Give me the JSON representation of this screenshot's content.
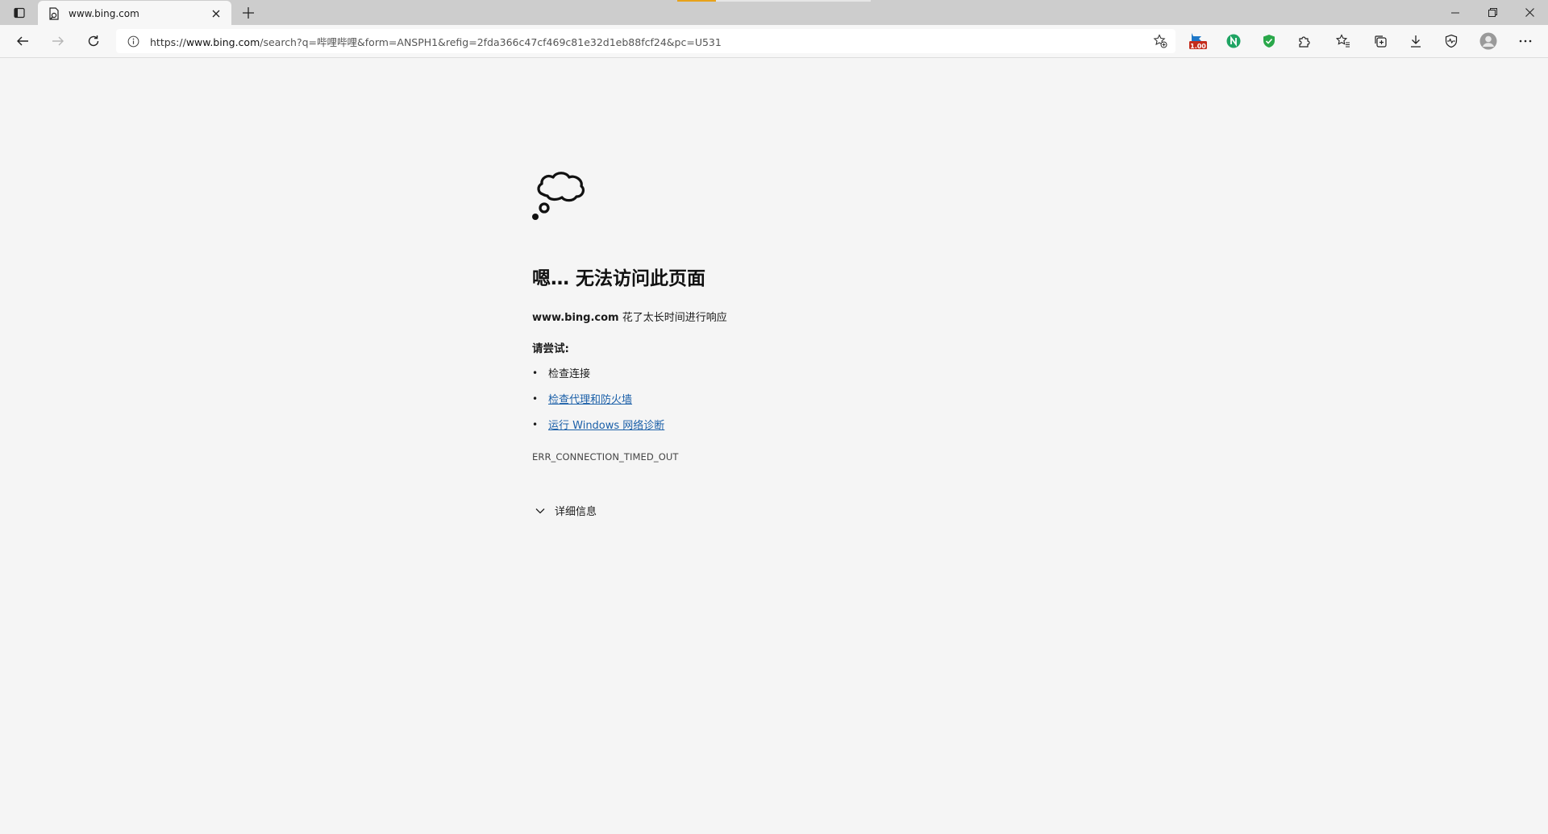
{
  "browser": {
    "tab": {
      "title": "www.bing.com",
      "favicon": "document-icon"
    },
    "address": {
      "scheme": "https://",
      "host": "www.bing.com",
      "path": "/search?q=哔哩哔哩&form=ANSPH1&refig=2fda366c47cf469c81e32d1eb88fcf24&pc=U531"
    },
    "extension_badge": "1.00",
    "accent_colors": {
      "loading": "#e8a21a",
      "badge_red": "#c42b1c",
      "green_ext": "#1fa463",
      "shield_green": "#2aa84a",
      "link": "#1a5fa8"
    }
  },
  "error_page": {
    "title": "嗯… 无法访问此页面",
    "host": "www.bing.com",
    "message": " 花了太长时间进行响应",
    "try_label": "请尝试:",
    "suggestions": [
      {
        "text": "检查连接",
        "link": false
      },
      {
        "text": "检查代理和防火墙",
        "link": true
      },
      {
        "text": "运行 Windows 网络诊断",
        "link": true
      }
    ],
    "error_code": "ERR_CONNECTION_TIMED_OUT",
    "details_label": "详细信息"
  }
}
